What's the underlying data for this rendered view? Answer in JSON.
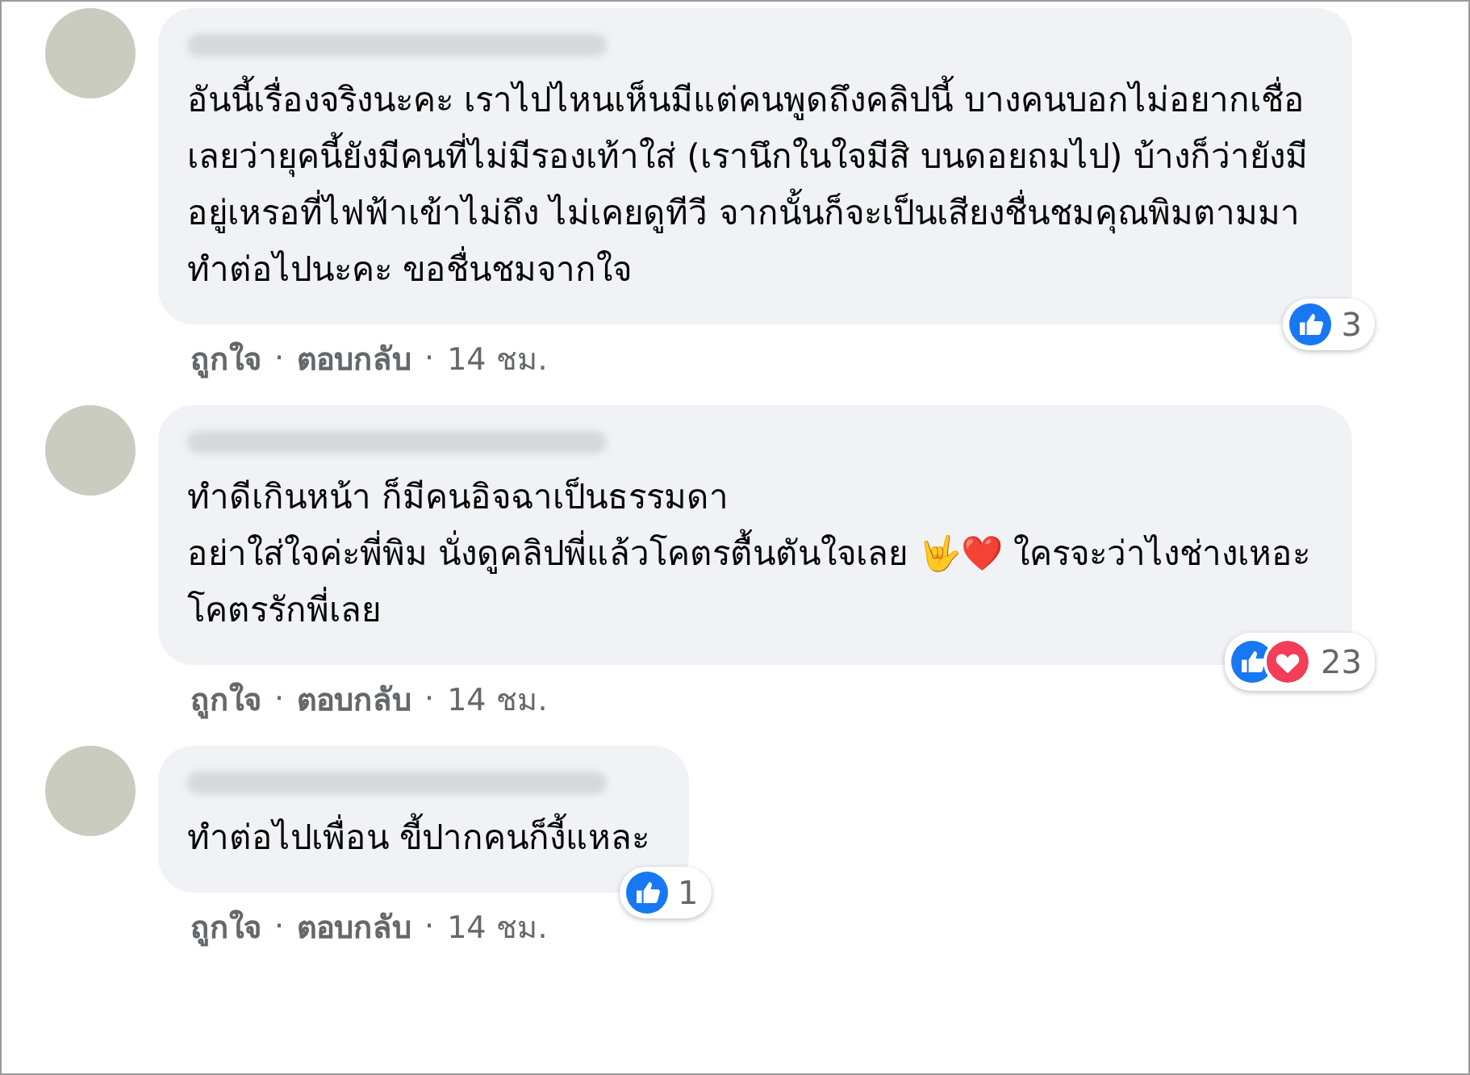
{
  "comments": [
    {
      "paragraphs": [
        "อันนี้เรื่องจริงนะคะ เราไปไหนเห็นมีแต่คนพูดถึงคลิปนี้ บางคนบอกไม่อยากเชื่อเลยว่ายุคนี้ยังมีคนที่ไม่มีรองเท้าใส่ (เรานึกในใจมีสิ บนดอยถมไป) บ้างก็ว่ายังมีอยู่เหรอที่ไฟฟ้าเข้าไม่ถึง ไม่เคยดูทีวี จากนั้นก็จะเป็นเสียงชื่นชมคุณพิมตามมา ทำต่อไปนะคะ ขอชื่นชมจากใจ"
      ],
      "reactions": [
        {
          "kind": "like"
        }
      ],
      "reaction_count": "3",
      "actions": [
        "ถูกใจ",
        "ตอบกลับ"
      ],
      "separator": "·",
      "time": "14 ชม."
    },
    {
      "paragraphs": [
        "ทำดีเกินหน้า ก็มีคนอิจฉาเป็นธรรมดา",
        "อย่าใส่ใจค่ะพี่พิม นั่งดูคลิปพี่แล้วโคตรตื้นตันใจเลย 🤟❤️ ใครจะว่าไงช่างเหอะ โคตรรักพี่เลย"
      ],
      "reactions": [
        {
          "kind": "like"
        },
        {
          "kind": "love"
        }
      ],
      "reaction_count": "23",
      "actions": [
        "ถูกใจ",
        "ตอบกลับ"
      ],
      "separator": "·",
      "time": "14 ชม."
    },
    {
      "paragraphs": [
        "ทำต่อไปเพื่อน ขี้ปากคนก็งี้แหละ"
      ],
      "reactions": [
        {
          "kind": "like"
        }
      ],
      "reaction_count": "1",
      "actions": [
        "ถูกใจ",
        "ตอบกลับ"
      ],
      "separator": "·",
      "time": "14 ชม."
    }
  ]
}
